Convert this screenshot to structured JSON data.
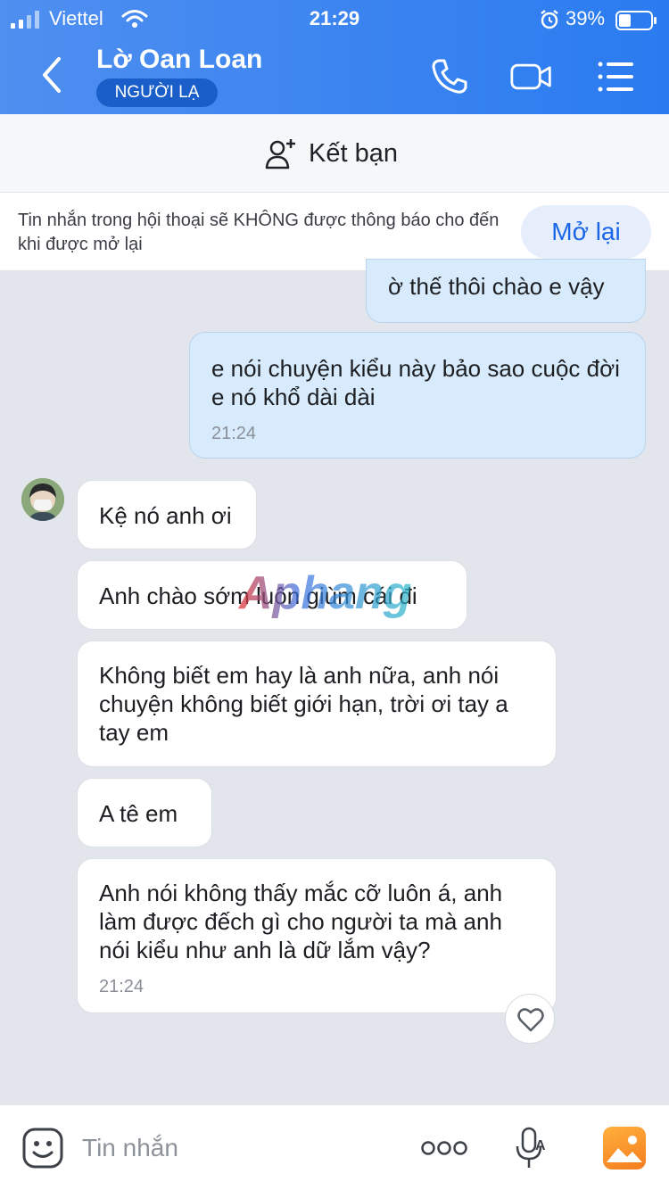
{
  "status_bar": {
    "carrier": "Viettel",
    "time": "21:29",
    "battery_percent": "39%",
    "icons": [
      "signal-icon",
      "wifi-icon",
      "alarm-icon",
      "battery-icon"
    ]
  },
  "header": {
    "contact_name": "Lờ Oan Loan",
    "badge": "NGƯỜI LẠ",
    "icons": [
      "back-icon",
      "phone-icon",
      "video-call-icon",
      "menu-icon"
    ],
    "accent_color": "#2a7bf0"
  },
  "add_friend": {
    "label": "Kết bạn",
    "icon": "add-user-icon"
  },
  "notice": {
    "text": "Tin nhắn trong hội thoại sẽ KHÔNG được thông báo cho đến khi được mở lại",
    "button_label": "Mở lại"
  },
  "messages": [
    {
      "direction": "outgoing",
      "text": "ờ thế thôi chào e vậy",
      "time": ""
    },
    {
      "direction": "outgoing",
      "text": "e nói chuyện kiểu này bảo sao cuộc đời e nó khổ dài dài",
      "time": "21:24"
    },
    {
      "direction": "incoming",
      "text": "Kệ nó anh ơi",
      "time": ""
    },
    {
      "direction": "incoming",
      "text": "Anh chào sớm luôn giùm cái đi",
      "time": ""
    },
    {
      "direction": "incoming",
      "text": "Không biết em hay là anh nữa, anh nói chuyện không biết giới hạn, trời ơi tay a tay em",
      "time": ""
    },
    {
      "direction": "incoming",
      "text": "A tê em",
      "time": ""
    },
    {
      "direction": "incoming",
      "text": "Anh nói không thấy mắc cỡ luôn á, anh làm được đếch gì cho người ta mà anh nói kiểu như anh là dữ lắm vậy?",
      "time": "21:24"
    }
  ],
  "watermark": "Aphang",
  "input_bar": {
    "placeholder": "Tin nhắn",
    "icons": [
      "emoji-icon",
      "more-icon",
      "mic-icon",
      "photo-icon"
    ]
  }
}
